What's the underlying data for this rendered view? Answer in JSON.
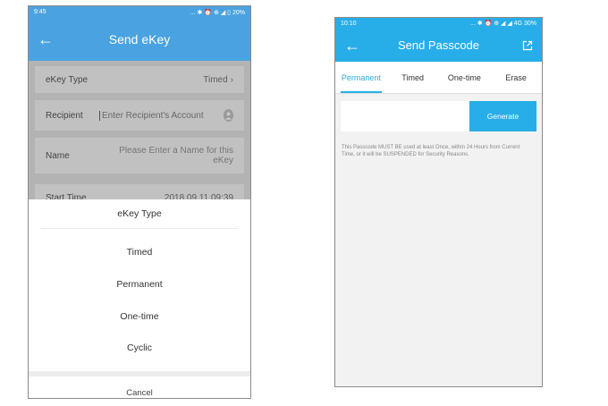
{
  "screen1": {
    "status": {
      "time": "9:45",
      "icons": "... ✱ ⏰ ⊕ ◢ ▯",
      "battery": "20%"
    },
    "title": "Send eKey",
    "form": {
      "type_label": "eKey Type",
      "type_value": "Timed",
      "recipient_label": "Recipient",
      "recipient_placeholder": "Enter Recipient's Account",
      "name_label": "Name",
      "name_placeholder": "Please Enter a Name for this eKey",
      "start_label": "Start Time",
      "start_value": "2018.09.11 09:39"
    },
    "sheet": {
      "title": "eKey Type",
      "options": [
        "Timed",
        "Permanent",
        "One-time",
        "Cyclic"
      ],
      "cancel": "Cancel"
    }
  },
  "screen2": {
    "status": {
      "time": "10:10",
      "icons": "... ✱ ⏰ ⊕ ◢ ◢ 4G",
      "battery": "30%"
    },
    "title": "Send Passcode",
    "tabs": [
      "Permanent",
      "Timed",
      "One-time",
      "Erase"
    ],
    "generate_label": "Generate",
    "note": "This Passcode MUST BE used at least Once, within 24 Hours from Current Time, or it will be SUSPENDED for Security Reasons."
  },
  "colors": {
    "accent1": "#4aa3e0",
    "accent2": "#27aee8"
  },
  "icons": [
    "back-arrow-icon",
    "chevron-right-icon",
    "contact-icon",
    "share-icon"
  ]
}
